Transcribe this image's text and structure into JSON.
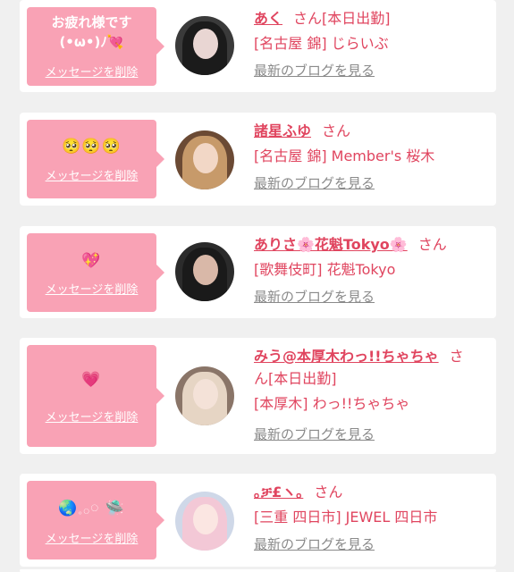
{
  "cards": [
    {
      "message": "お疲れ様です(•ω•)ﾉ💘",
      "delete_label": "メッセージを削除",
      "name": "あく",
      "san": "さん",
      "status": "[本日出勤]",
      "shop": "[名古屋 錦] じらいぶ",
      "blog_label": "最新のブログを見る"
    },
    {
      "message": "🥺🥺🥺",
      "delete_label": "メッセージを削除",
      "name": "諸星ふゆ",
      "san": "さん",
      "shop": "[名古屋 錦] Member's 桜木",
      "blog_label": "最新のブログを見る"
    },
    {
      "message": "💖",
      "delete_label": "メッセージを削除",
      "name": "ありさ🌸花魁Tokyo🌸",
      "san": "さん",
      "shop": "[歌舞伎町] 花魁Tokyo",
      "blog_label": "最新のブログを見る"
    },
    {
      "message": "💗",
      "delete_label": "メッセージを削除",
      "name": "みう@本厚木わっ!!ちゃちゃ",
      "san": "さ",
      "san_cont": "ん",
      "status": "[本日出勤]",
      "shop": "[本厚木] わっ!!ちゃちゃ",
      "blog_label": "最新のブログを見る"
    },
    {
      "message": "🌏𓈒𓂂𓏸 🛸",
      "delete_label": "メッセージを削除",
      "name": "｡ቻ£ヽ｡",
      "san": "さん",
      "shop": "[三重 四日市] JEWEL 四日市",
      "blog_label": "最新のブログを見る"
    }
  ],
  "colors": {
    "accent": "#e0455f",
    "bubble": "#f9a2b5",
    "background": "#f0f0f0",
    "link_gray": "#8a8a8a"
  }
}
